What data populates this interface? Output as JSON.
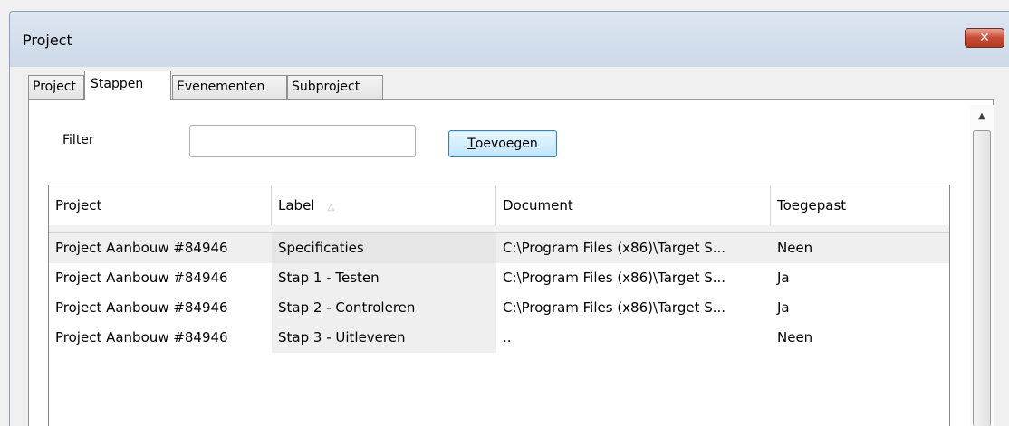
{
  "window": {
    "title": "Project",
    "close_label": "✕"
  },
  "tabs": [
    {
      "label": "Project"
    },
    {
      "label": "Stappen"
    },
    {
      "label": "Evenementen"
    },
    {
      "label": "Subproject"
    }
  ],
  "filter": {
    "label": "Filter",
    "value": "",
    "placeholder": ""
  },
  "add_button": {
    "accel": "T",
    "rest": "oevoegen"
  },
  "grid": {
    "columns": [
      "Project",
      "Label",
      "Document",
      "Toegepast"
    ],
    "sorted_column": "Label",
    "sort_icon": "sort-up-icon",
    "rows": [
      {
        "project": "Project Aanbouw #84946",
        "label": "Specificaties",
        "document": "C:\\Program Files (x86)\\Target S...",
        "applied": "Neen"
      },
      {
        "project": "Project Aanbouw #84946",
        "label": "Stap 1 - Testen",
        "document": "C:\\Program Files (x86)\\Target S...",
        "applied": "Ja"
      },
      {
        "project": "Project Aanbouw #84946",
        "label": "Stap 2 - Controleren",
        "document": "C:\\Program Files (x86)\\Target S...",
        "applied": "Ja"
      },
      {
        "project": "Project Aanbouw #84946",
        "label": "Stap 3 - Uitleveren",
        "document": "..",
        "applied": "Neen"
      }
    ]
  }
}
